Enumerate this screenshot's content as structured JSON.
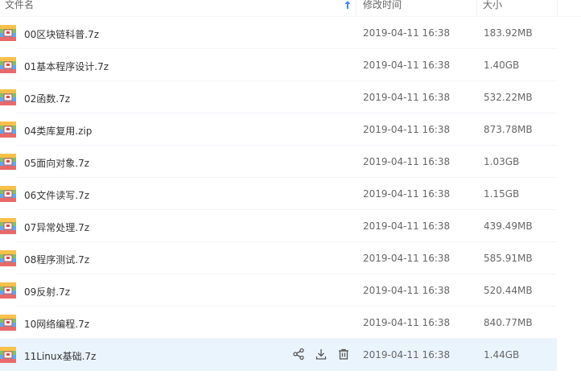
{
  "header": {
    "name_label": "文件名",
    "time_label": "修改时间",
    "size_label": "大小"
  },
  "colors": {
    "accent": "#3b8cff",
    "hover_row": "#eaf4fd"
  },
  "files": [
    {
      "name": "00区块链科普.7z",
      "time": "2019-04-11 16:38",
      "size": "183.92MB"
    },
    {
      "name": "01基本程序设计.7z",
      "time": "2019-04-11 16:38",
      "size": "1.40GB"
    },
    {
      "name": "02函数.7z",
      "time": "2019-04-11 16:38",
      "size": "532.22MB"
    },
    {
      "name": "04类库复用.zip",
      "time": "2019-04-11 16:38",
      "size": "873.78MB"
    },
    {
      "name": "05面向对象.7z",
      "time": "2019-04-11 16:38",
      "size": "1.03GB"
    },
    {
      "name": "06文件读写.7z",
      "time": "2019-04-11 16:38",
      "size": "1.15GB"
    },
    {
      "name": "07异常处理.7z",
      "time": "2019-04-11 16:38",
      "size": "439.49MB"
    },
    {
      "name": "08程序测试.7z",
      "time": "2019-04-11 16:38",
      "size": "585.91MB"
    },
    {
      "name": "09反射.7z",
      "time": "2019-04-11 16:38",
      "size": "520.44MB"
    },
    {
      "name": "10网络编程.7z",
      "time": "2019-04-11 16:38",
      "size": "840.77MB"
    },
    {
      "name": "11Linux基础.7z",
      "time": "2019-04-11 16:38",
      "size": "1.44GB"
    }
  ],
  "hover_row_actions": [
    "share-icon",
    "download-icon",
    "delete-icon"
  ]
}
